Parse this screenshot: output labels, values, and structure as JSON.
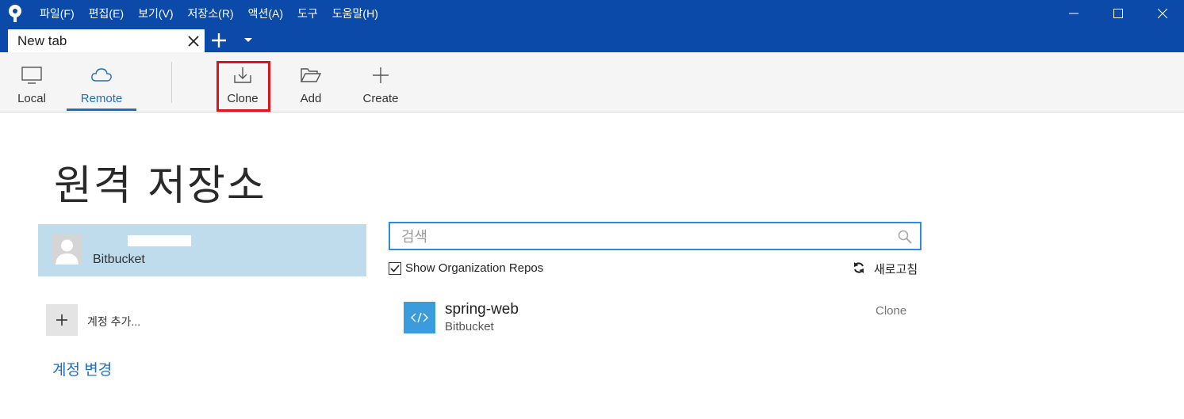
{
  "menu": {
    "items": [
      "파일(F)",
      "편집(E)",
      "보기(V)",
      "저장소(R)",
      "액션(A)",
      "도구",
      "도움말(H)"
    ]
  },
  "tabs": [
    {
      "label": "New tab"
    }
  ],
  "toolbar": {
    "local_label": "Local",
    "remote_label": "Remote",
    "clone_label": "Clone",
    "add_label": "Add",
    "create_label": "Create"
  },
  "page": {
    "title": "원격 저장소"
  },
  "account": {
    "provider": "Bitbucket",
    "add_label": "계정 추가...",
    "change_label": "계정 변경"
  },
  "search": {
    "placeholder": "검색"
  },
  "options": {
    "show_org_repos_label": "Show Organization Repos",
    "show_org_repos_checked": true,
    "refresh_label": "새로고침"
  },
  "repos": [
    {
      "name": "spring-web",
      "source": "Bitbucket",
      "action": "Clone"
    }
  ],
  "colors": {
    "titlebar": "#0b4aa8",
    "accent": "#1e6fc4",
    "account_selected": "#bedcec",
    "highlight_box": "#e0121b",
    "repo_icon": "#3b9bdb"
  }
}
